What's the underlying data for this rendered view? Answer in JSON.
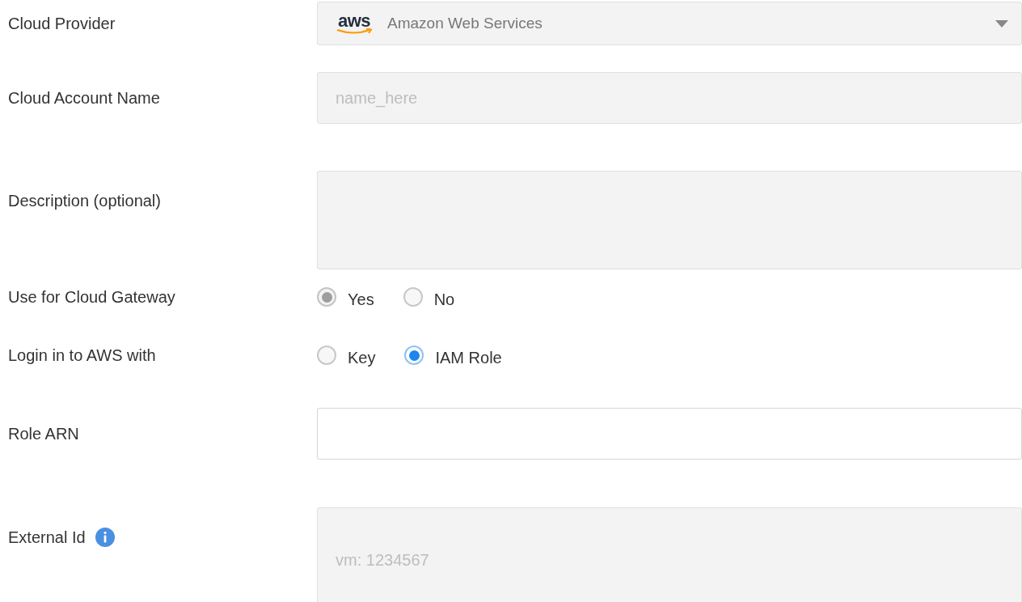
{
  "fields": [
    {
      "kind": "select",
      "label": "Cloud Provider",
      "logo_text": "aws",
      "value": "Amazon Web Services",
      "disabled": true
    },
    {
      "kind": "input",
      "label": "Cloud Account Name",
      "placeholder": "name_here",
      "disabled": true
    },
    {
      "kind": "textarea",
      "label": "Description (optional)",
      "disabled": true
    },
    {
      "kind": "radio",
      "label": "Use for Cloud Gateway",
      "disabled": true,
      "options": [
        {
          "label": "Yes",
          "selected": true
        },
        {
          "label": "No",
          "selected": false
        }
      ]
    },
    {
      "kind": "radio",
      "label": "Login in to AWS with",
      "disabled": false,
      "options": [
        {
          "label": "Key",
          "selected": false
        },
        {
          "label": "IAM Role",
          "selected": true
        }
      ]
    },
    {
      "kind": "input",
      "label": "Role ARN",
      "disabled": false
    },
    {
      "kind": "tall_input",
      "label": "External Id",
      "info": true,
      "placeholder": "vm: 1234567",
      "disabled": true
    }
  ]
}
